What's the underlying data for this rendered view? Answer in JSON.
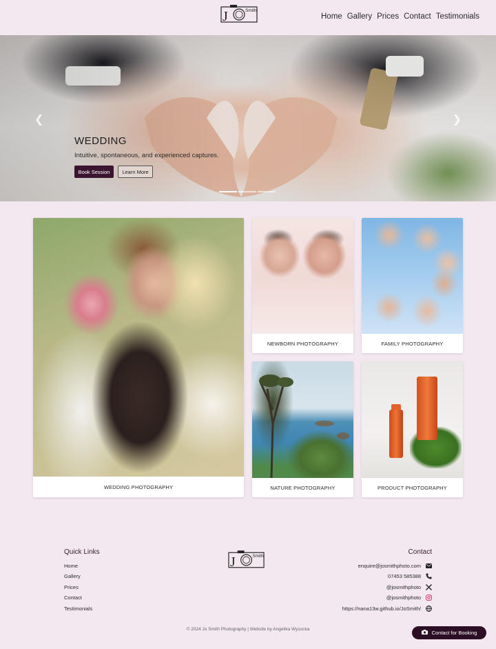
{
  "header": {
    "logo_letter": "J",
    "logo_word": "Smith",
    "nav": [
      "Home",
      "Gallery",
      "Prices",
      "Contact",
      "Testimonials"
    ]
  },
  "hero": {
    "title": "WEDDING",
    "subtitle": "Intuitive, spontaneous, and experienced captures.",
    "book_label": "Book Session",
    "learn_label": "Learn More",
    "slides_count": 3,
    "active_slide": 1
  },
  "gallery": {
    "wedding": "WEDDING PHOTOGRAPHY",
    "newborn": "NEWBORN PHOTOGRAPHY",
    "family": "FAMILY PHOTOGRAPHY",
    "nature": "NATURE PHOTOGRAPHY",
    "product": "PRODUCT PHOTOGRAPHY"
  },
  "footer": {
    "quick_links_title": "Quick Links",
    "quick_links": [
      "Home",
      "Gallery",
      "Prices",
      "Contact",
      "Testimonials"
    ],
    "contact_title": "Contact",
    "contact": [
      {
        "text": "enquire@josmithphoto.com",
        "icon": "envelope-icon"
      },
      {
        "text": "07453 585388",
        "icon": "phone-icon"
      },
      {
        "text": "@josmithphoto",
        "icon": "x-twitter-icon"
      },
      {
        "text": "@josmithphoto",
        "icon": "instagram-icon"
      },
      {
        "text": "https://nana13w.github.io/JoSmith/",
        "icon": "globe-icon"
      }
    ],
    "copyright": "© 2024 Jo Smith Photography | Website by Angelika Wysocka",
    "fab_label": "Contact for Booking"
  },
  "colors": {
    "page_bg": "#f3e8f0",
    "accent": "#3a1430",
    "fab_bg": "#2c0f24",
    "instagram": "#d6336c"
  }
}
